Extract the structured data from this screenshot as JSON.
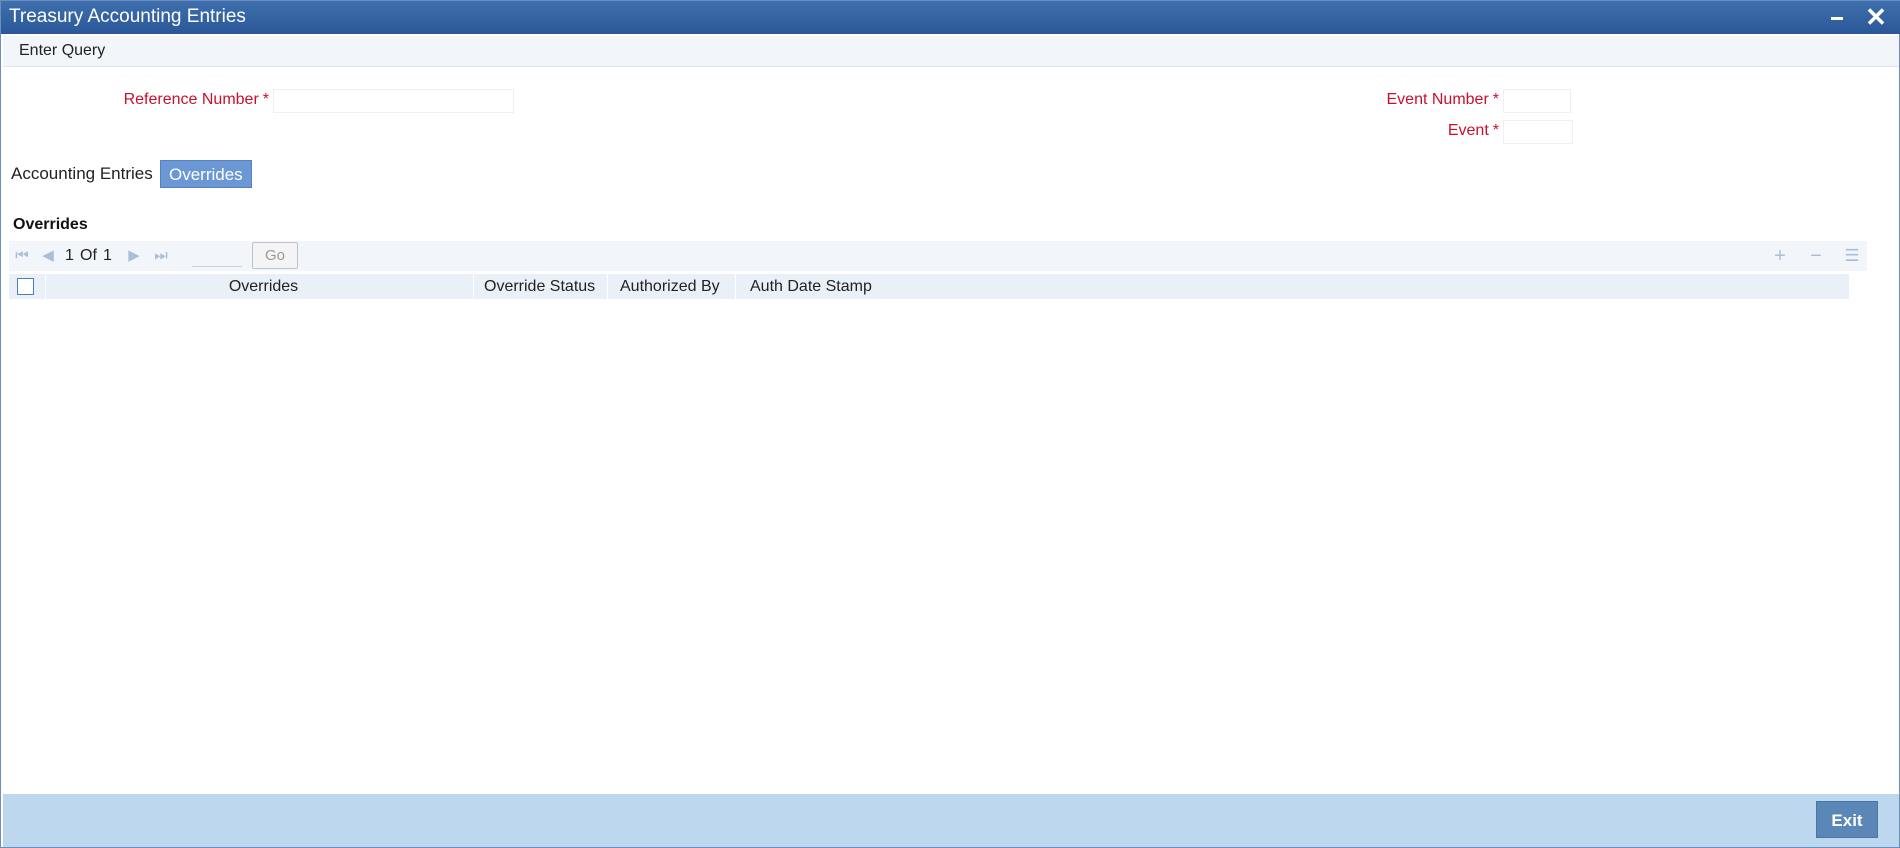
{
  "window": {
    "title": "Treasury Accounting Entries"
  },
  "menu": {
    "enter_query": "Enter Query"
  },
  "form": {
    "reference_number_label": "Reference Number",
    "event_number_label": "Event Number",
    "event_label": "Event",
    "required_marker": "*",
    "reference_number_value": "",
    "event_number_value": "",
    "event_value": ""
  },
  "tabs": [
    {
      "label": "Accounting Entries",
      "active": false
    },
    {
      "label": "Overrides",
      "active": true
    }
  ],
  "overrides_section": {
    "title": "Overrides",
    "pagination": {
      "current": "1",
      "of_label": "Of",
      "total": "1",
      "go_label": "Go"
    },
    "columns": [
      "Overrides",
      "Override Status",
      "Authorized By",
      "Auth Date Stamp"
    ],
    "rows": []
  },
  "footer": {
    "exit_label": "Exit"
  },
  "colors": {
    "titlebar": "#2f5f9f",
    "required_label": "#c8102e",
    "active_tab": "#6b98d4",
    "footer": "#bdd7ee",
    "exit_button": "#5a87b8"
  },
  "icons": {
    "first_page": "first-page-icon",
    "prev_page": "prev-page-icon",
    "next_page": "next-page-icon",
    "last_page": "last-page-icon",
    "add_row": "plus-icon",
    "delete_row": "minus-icon",
    "single_view": "list-view-icon"
  }
}
